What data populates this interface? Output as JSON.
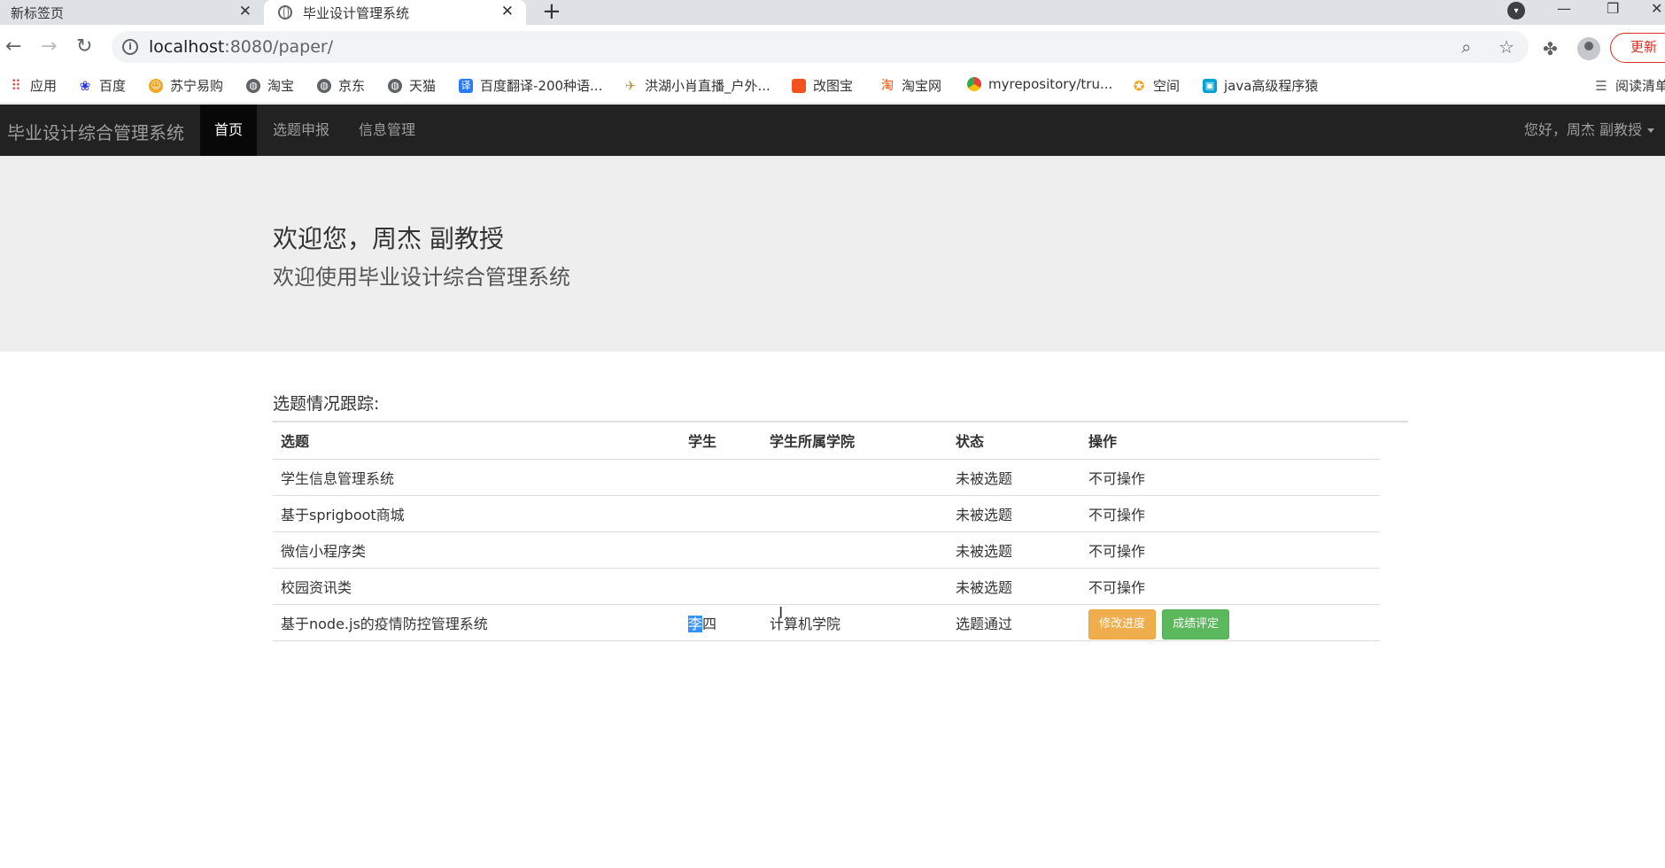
{
  "browser": {
    "tabs": [
      {
        "title": "新标签页",
        "active": false
      },
      {
        "title": "毕业设计管理系统",
        "active": true
      }
    ],
    "url_host": "localhost",
    "url_rest": ":8080/paper/",
    "update_label": "更新",
    "reading_mode": "阅读清单",
    "bookmarks": [
      {
        "label": "应用",
        "icon": "apps-grid-icon",
        "color": "#ea4335"
      },
      {
        "label": "百度",
        "icon": "baidu-paw-icon",
        "color": "#2932e1"
      },
      {
        "label": "苏宁易购",
        "icon": "suning-icon",
        "color": "#f5a623"
      },
      {
        "label": "淘宝",
        "icon": "globe-icon",
        "color": "#5f6368"
      },
      {
        "label": "京东",
        "icon": "globe-icon",
        "color": "#5f6368"
      },
      {
        "label": "天猫",
        "icon": "globe-icon",
        "color": "#5f6368"
      },
      {
        "label": "百度翻译-200种语...",
        "icon": "translate-icon",
        "color": "#2a7cf6"
      },
      {
        "label": "洪湖小肖直播_户外...",
        "icon": "bird-icon",
        "color": "#c0a050"
      },
      {
        "label": "改图宝",
        "icon": "gaitubao-icon",
        "color": "#f5511e"
      },
      {
        "label": "淘宝网",
        "icon": "taobao-icon",
        "color": "#ff5000"
      },
      {
        "label": "myrepository/tru...",
        "icon": "chrome-icon",
        "color": "#34a853"
      },
      {
        "label": "空间",
        "icon": "qzone-icon",
        "color": "#f7a21b"
      },
      {
        "label": "java高级程序猿",
        "icon": "bilibili-icon",
        "color": "#00a1d6"
      }
    ]
  },
  "navbar": {
    "brand": "毕业设计综合管理系统",
    "items": [
      {
        "label": "首页",
        "active": true
      },
      {
        "label": "选题申报",
        "active": false
      },
      {
        "label": "信息管理",
        "active": false
      }
    ],
    "user_greeting": "您好，周杰 副教授"
  },
  "jumbotron": {
    "welcome": "欢迎您，周杰 副教授",
    "subtitle": "欢迎使用毕业设计综合管理系统"
  },
  "tracking": {
    "title": "选题情况跟踪:",
    "columns": [
      "选题",
      "学生",
      "学生所属学院",
      "状态",
      "操作"
    ],
    "rows": [
      {
        "topic": "学生信息管理系统",
        "student": "",
        "college": "",
        "status": "未被选题",
        "action": "不可操作"
      },
      {
        "topic": "基于sprigboot商城",
        "student": "",
        "college": "",
        "status": "未被选题",
        "action": "不可操作"
      },
      {
        "topic": "微信小程序类",
        "student": "",
        "college": "",
        "status": "未被选题",
        "action": "不可操作"
      },
      {
        "topic": "校园资讯类",
        "student": "",
        "college": "",
        "status": "未被选题",
        "action": "不可操作"
      }
    ],
    "last_row": {
      "topic": "基于node.js的疫情防控管理系统",
      "student_selected": "李",
      "student_rest": "四",
      "college": "计算机学院",
      "status": "选题通过",
      "btn_progress": "修改进度",
      "btn_grade": "成绩评定"
    }
  }
}
